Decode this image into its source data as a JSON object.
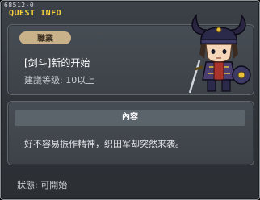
{
  "window": {
    "id": "68512-0",
    "title": "QUEST INFO"
  },
  "quest": {
    "job_tag": "職業",
    "name": "[剑斗]新的开始",
    "level_label": "建議等级",
    "level_sep": ":",
    "level_value": "10以上"
  },
  "content": {
    "header": "內容",
    "text": "好不容易振作精神，织田军却突然来袭。"
  },
  "status": {
    "label": "狀態",
    "sep": ":",
    "value": "可開始"
  },
  "character": {
    "icon": "samurai-warrior-sprite"
  },
  "colors": {
    "title": "#f3d23b",
    "tag_bg": "#c9b18a",
    "panel_bg": "#474d54"
  }
}
